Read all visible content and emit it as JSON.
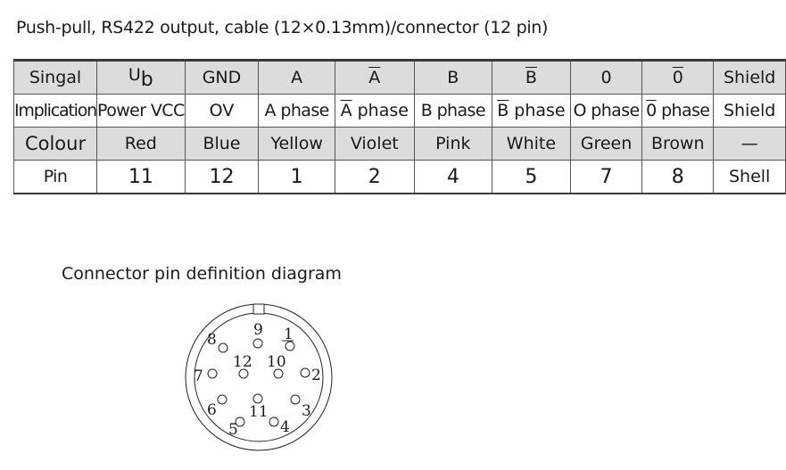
{
  "title": "Push-pull, RS422 output, cable (12×0.13mm)/connector (12 pin)",
  "table": {
    "rows": [
      {
        "label": "Singal",
        "cells": [
          {
            "text": "U",
            "sub": "b"
          },
          {
            "text": "GND"
          },
          {
            "text": "A"
          },
          {
            "text": "A",
            "overline": true
          },
          {
            "text": "B"
          },
          {
            "text": "B",
            "overline": true
          },
          {
            "text": "0"
          },
          {
            "text": "0",
            "overline": true
          },
          {
            "text": "Shield"
          }
        ]
      },
      {
        "label": "Implication",
        "cells": [
          {
            "text": "Power VCC"
          },
          {
            "text": "OV"
          },
          {
            "text": "A phase"
          },
          {
            "prefix": "A",
            "overline": true,
            "text": " phase"
          },
          {
            "text": "B phase"
          },
          {
            "prefix": "B",
            "overline": true,
            "text": " phase"
          },
          {
            "text": "O phase"
          },
          {
            "prefix": "0",
            "overline": true,
            "text": " phase"
          },
          {
            "text": "Shield"
          }
        ]
      },
      {
        "label": "Colour",
        "cells": [
          {
            "text": "Red"
          },
          {
            "text": "Blue"
          },
          {
            "text": "Yellow"
          },
          {
            "text": "Violet"
          },
          {
            "text": "Pink"
          },
          {
            "text": "White"
          },
          {
            "text": "Green"
          },
          {
            "text": "Brown"
          },
          {
            "text": "—"
          }
        ]
      },
      {
        "label": "Pin",
        "cells": [
          {
            "text": "11"
          },
          {
            "text": "12"
          },
          {
            "text": "1"
          },
          {
            "text": "2"
          },
          {
            "text": "4"
          },
          {
            "text": "5"
          },
          {
            "text": "7"
          },
          {
            "text": "8"
          },
          {
            "text": "Shell"
          }
        ]
      }
    ]
  },
  "diagram": {
    "title": "Connector pin definition diagram",
    "pins": [
      "1",
      "2",
      "3",
      "4",
      "5",
      "6",
      "7",
      "8",
      "9",
      "10",
      "11",
      "12"
    ]
  }
}
